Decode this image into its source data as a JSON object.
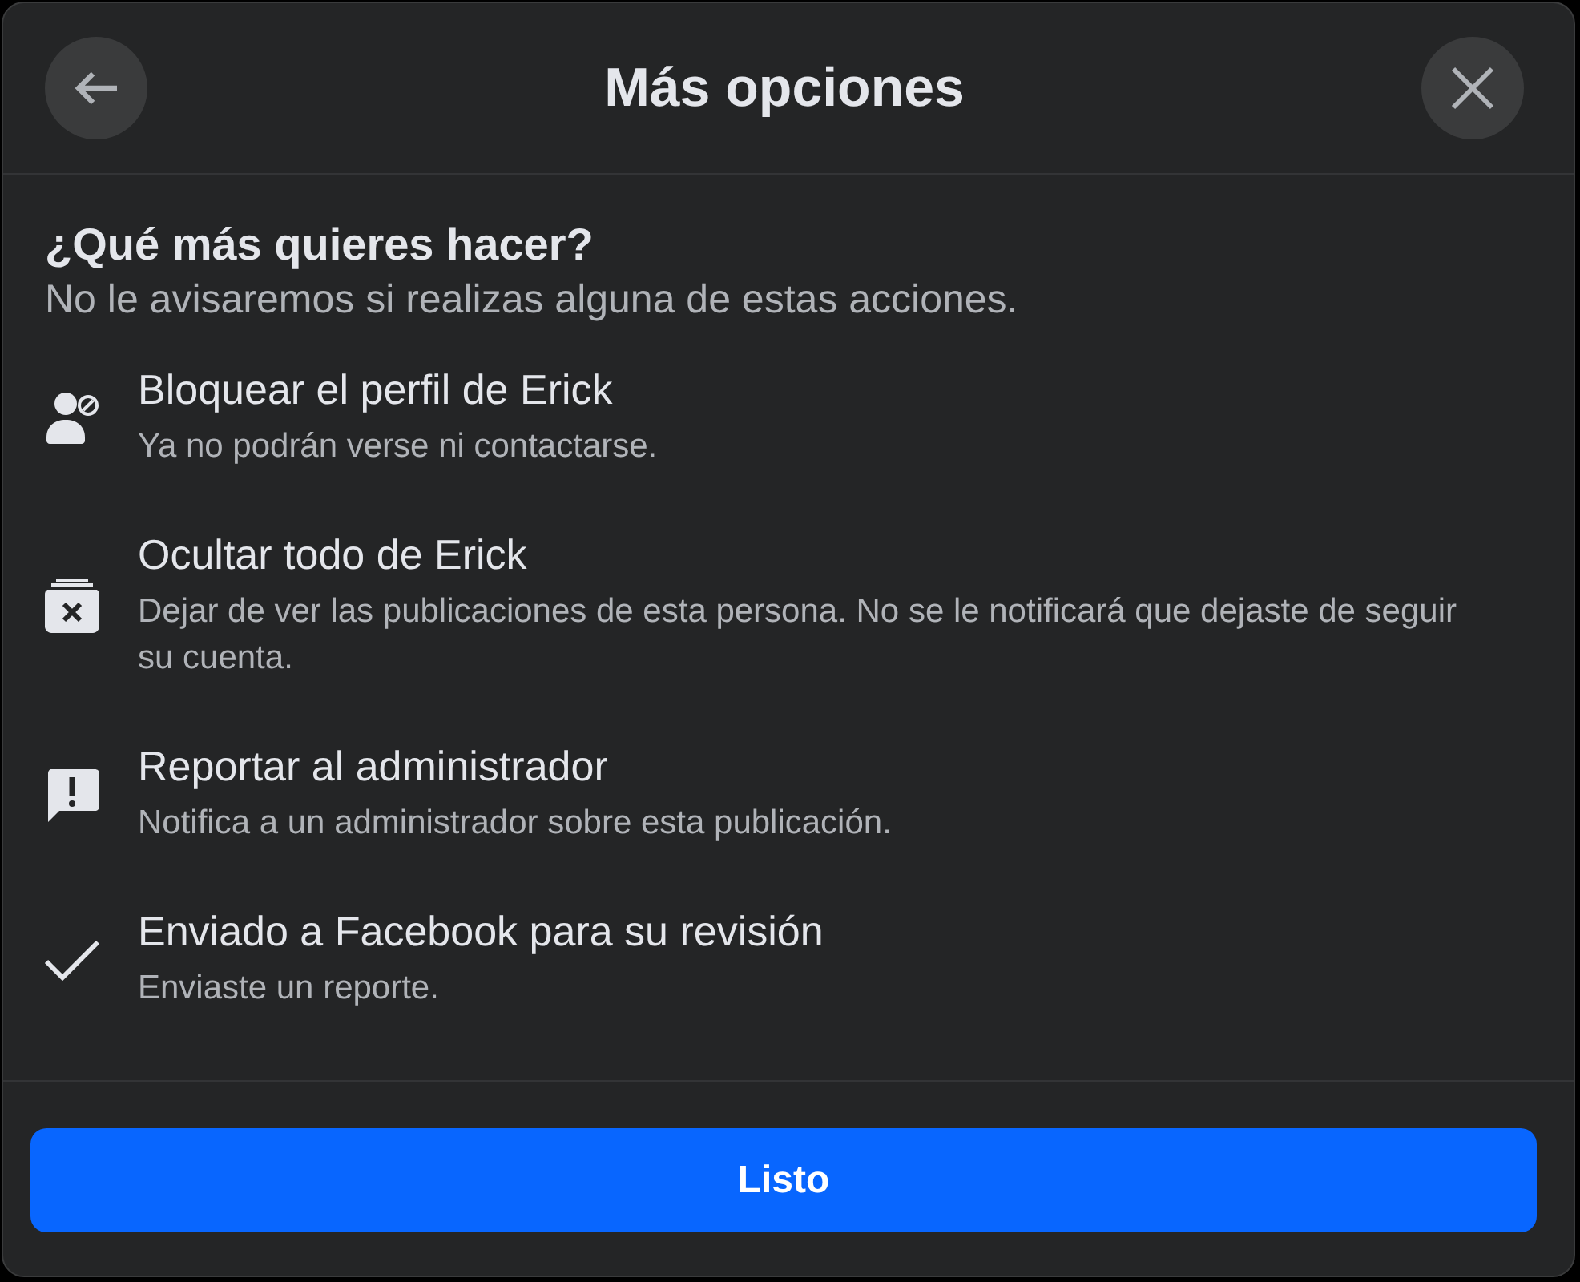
{
  "dialog": {
    "title": "Más opciones"
  },
  "heading": "¿Qué más quieres hacer?",
  "subheading": "No le avisaremos si realizas alguna de estas acciones.",
  "options": [
    {
      "kind": "block",
      "title": "Bloquear el perfil de Erick",
      "description": "Ya no podrán verse ni contactarse."
    },
    {
      "kind": "hide",
      "title": "Ocultar todo de Erick",
      "description": "Dejar de ver las publicaciones de esta persona. No se le notificará que dejaste de seguir su cuenta."
    },
    {
      "kind": "report",
      "title": "Reportar al administrador",
      "description": "Notifica a un administrador sobre esta publicación."
    },
    {
      "kind": "done",
      "title": "Enviado a Facebook para su revisión",
      "description": "Enviaste un reporte."
    }
  ],
  "button": "Listo"
}
